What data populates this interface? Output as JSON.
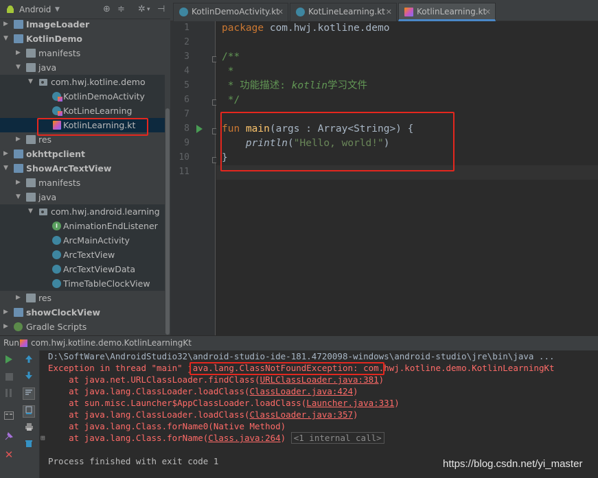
{
  "project_pane": {
    "view_selector": "Android",
    "tree": [
      {
        "label": "ImageLoader",
        "bold": true,
        "type": "module",
        "arrow": "collapsed"
      },
      {
        "label": "KotlinDemo",
        "bold": true,
        "type": "module",
        "arrow": "expanded"
      },
      {
        "label": "manifests",
        "type": "folder",
        "arrow": "collapsed"
      },
      {
        "label": "java",
        "type": "folder",
        "arrow": "expanded"
      },
      {
        "label": "com.hwj.kotline.demo",
        "type": "package",
        "arrow": "expanded"
      },
      {
        "label": "KotlinDemoActivity",
        "type": "kotlin-class"
      },
      {
        "label": "KotLineLearning",
        "type": "kotlin-class"
      },
      {
        "label": "KotlinLearning.kt",
        "type": "kotlin-file",
        "selected": true
      },
      {
        "label": "res",
        "type": "folder",
        "arrow": "collapsed"
      },
      {
        "label": "okhttpclient",
        "bold": true,
        "type": "module",
        "arrow": "collapsed"
      },
      {
        "label": "ShowArcTextView",
        "bold": true,
        "type": "module",
        "arrow": "expanded"
      },
      {
        "label": "manifests",
        "type": "folder",
        "arrow": "collapsed"
      },
      {
        "label": "java",
        "type": "folder",
        "arrow": "expanded"
      },
      {
        "label": "com.hwj.android.learning",
        "type": "package",
        "arrow": "expanded"
      },
      {
        "label": "AnimationEndListener",
        "type": "interface"
      },
      {
        "label": "ArcMainActivity",
        "type": "class"
      },
      {
        "label": "ArcTextView",
        "type": "class"
      },
      {
        "label": "ArcTextViewData",
        "type": "class"
      },
      {
        "label": "TimeTableClockView",
        "type": "class"
      },
      {
        "label": "res",
        "type": "folder",
        "arrow": "collapsed"
      },
      {
        "label": "showClockView",
        "bold": true,
        "type": "module",
        "arrow": "collapsed"
      },
      {
        "label": "Gradle Scripts",
        "type": "gradle",
        "arrow": "collapsed"
      }
    ]
  },
  "editor": {
    "tabs": [
      {
        "label": "KotlinDemoActivity.kt",
        "active": false
      },
      {
        "label": "KotLineLearning.kt",
        "active": false
      },
      {
        "label": "KotlinLearning.kt",
        "active": true
      }
    ],
    "line_numbers": [
      "1",
      "2",
      "3",
      "4",
      "5",
      "6",
      "7",
      "8",
      "9",
      "10",
      "11"
    ],
    "code": {
      "l1_kw": "package",
      "l1_rest": " com.hwj.kotline.demo",
      "l3": "/**",
      "l4": " *",
      "l5_a": " * 功能描述: ",
      "l5_b": "kotlin",
      "l5_c": "学习文件",
      "l6": " */",
      "l8_kw": "fun",
      "l8_fn": "main",
      "l8_rest": "(args : Array<String>) {",
      "l9_fn": "println",
      "l9_open": "(",
      "l9_str": "\"Hello, world!\"",
      "l9_close": ")",
      "l10": "}"
    }
  },
  "run_panel": {
    "header_label": "Run",
    "config_name": "com.hwj.kotline.demo.KotlinLearningKt",
    "console": {
      "l1": "D:\\SoftWare\\AndroidStudio32\\android-studio-ide-181.4720098-windows\\android-studio\\jre\\bin\\java ...",
      "l2_a": "Exception in thread \"main\" ",
      "l2_b": "java.lang.ClassNotFoundException:",
      "l2_c": " com.hwj.kotline.demo.KotlinLearningKt",
      "stack": [
        {
          "at": "    at java.net.URLClassLoader.findClass(",
          "link": "URLClassLoader.java:381",
          "end": ")"
        },
        {
          "at": "    at java.lang.ClassLoader.loadClass(",
          "link": "ClassLoader.java:424",
          "end": ")"
        },
        {
          "at": "    at sun.misc.Launcher$AppClassLoader.loadClass(",
          "link": "Launcher.java:331",
          "end": ")"
        },
        {
          "at": "    at java.lang.ClassLoader.loadClass(",
          "link": "ClassLoader.java:357",
          "end": ")"
        },
        {
          "at": "    at java.lang.Class.forName0(Native Method)",
          "link": "",
          "end": ""
        },
        {
          "at": "    at java.lang.Class.forName(",
          "link": "Class.java:264",
          "end": ")"
        }
      ],
      "internal_call": "<1 internal call>",
      "finished": "Process finished with exit code 1"
    }
  },
  "watermark": "https://blog.csdn.net/yi_master",
  "colors": {
    "annotation_box": "#e5271e",
    "keyword": "#cc7832",
    "function": "#ffc66d",
    "doc_comment": "#629755",
    "string": "#6a8759",
    "error_text": "#ff6b68"
  },
  "icons": [
    "android-icon",
    "target-icon",
    "split-icon",
    "settings-icon",
    "hide-icon",
    "run-icon",
    "stop-icon",
    "pause-icon",
    "up-icon",
    "down-icon",
    "soft-wrap-icon",
    "scroll-end-icon",
    "print-icon",
    "trash-icon",
    "pin-icon",
    "close-icon",
    "layout-icon"
  ]
}
